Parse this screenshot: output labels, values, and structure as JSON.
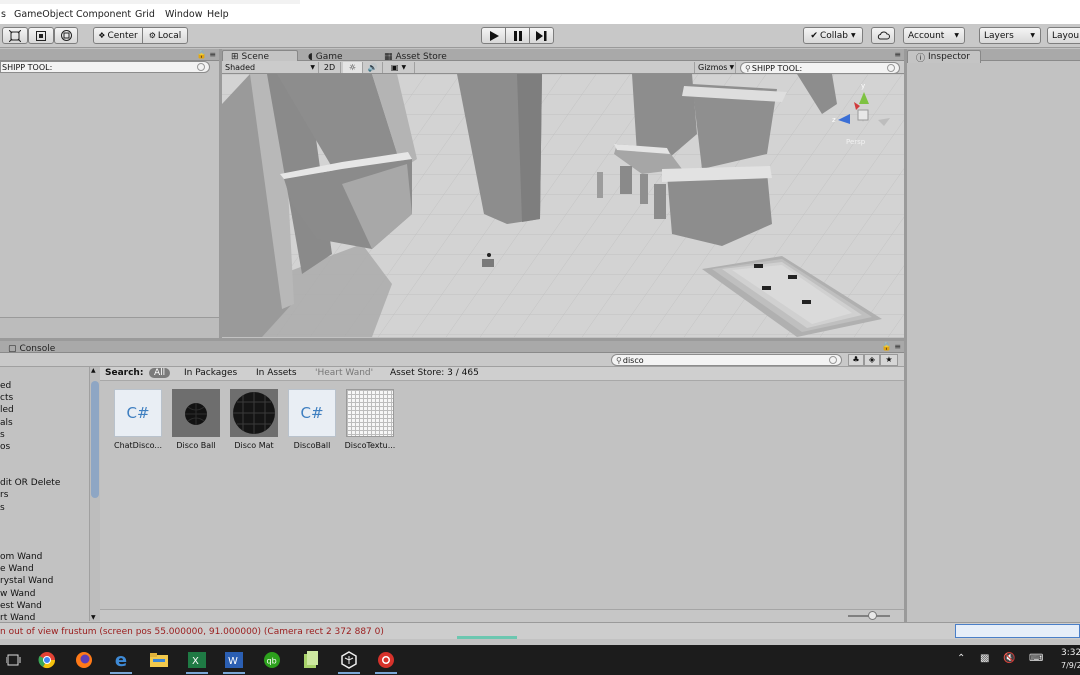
{
  "menubar": {
    "items": [
      "s",
      "GameObject",
      "Component",
      "Grid",
      "Window",
      "Help"
    ]
  },
  "toolbar": {
    "pivot_center": "Center",
    "pivot_local": "Local",
    "collab": "Collab",
    "account": "Account",
    "layers": "Layers",
    "layout": "Layou"
  },
  "hierarchy": {
    "search_text": "SHIPP TOOL:"
  },
  "scene_tabs": [
    {
      "label": "Scene",
      "icon": "grid-icon"
    },
    {
      "label": "Game",
      "icon": "pacman-icon"
    },
    {
      "label": "Asset Store",
      "icon": "store-icon"
    }
  ],
  "scene_toolbar": {
    "shading_mode": "Shaded",
    "two_d": "2D",
    "gizmos": "Gizmos",
    "search_text": "SHIPP TOOL:"
  },
  "scene_gizmo": {
    "y": "y",
    "z": "z",
    "view_label": "Persp"
  },
  "inspector": {
    "tab_label": "Inspector"
  },
  "console": {
    "tab_label": "Console"
  },
  "project": {
    "search_value": "disco",
    "search_label": "Search:",
    "filters": [
      "All",
      "In Packages",
      "In Assets",
      "'Heart Wand'",
      "Asset Store: 3 / 465"
    ],
    "tree_items": [
      "ed",
      "cts",
      "led",
      "als",
      "s",
      "os",
      "dit OR Delete",
      "rs",
      "s",
      "om Wand",
      "e Wand",
      "rystal Wand",
      "w Wand",
      "est Wand",
      "rt Wand"
    ],
    "assets": [
      {
        "name": "ChatDisco...",
        "kind": "csharp-script-icon",
        "glyph": "C#"
      },
      {
        "name": "Disco Ball",
        "kind": "disco-ball-thumb"
      },
      {
        "name": "Disco Mat",
        "kind": "disco-material-thumb"
      },
      {
        "name": "DiscoBall",
        "kind": "csharp-script-icon",
        "glyph": "C#"
      },
      {
        "name": "DiscoTextu...",
        "kind": "grid-texture-thumb"
      }
    ]
  },
  "status": {
    "message": "n out of view frustum (screen pos 55.000000, 91.000000) (Camera rect 2 372 887 0)"
  },
  "taskbar": {
    "apps": [
      "task-view-icon",
      "chrome-icon",
      "firefox-icon",
      "edge-icon",
      "file-explorer-icon",
      "excel-icon",
      "word-icon",
      "quickbooks-icon",
      "notepad-icon",
      "unity-icon",
      "chrome-alt-icon"
    ],
    "clock_time": "3:32",
    "clock_date": "7/9/2"
  },
  "colors": {
    "editor_bg": "#c2c2c2",
    "scene_gray": "#8d8d8d",
    "taskbar": "#1c1c1c",
    "selection_blue": "#8ea6c4"
  }
}
